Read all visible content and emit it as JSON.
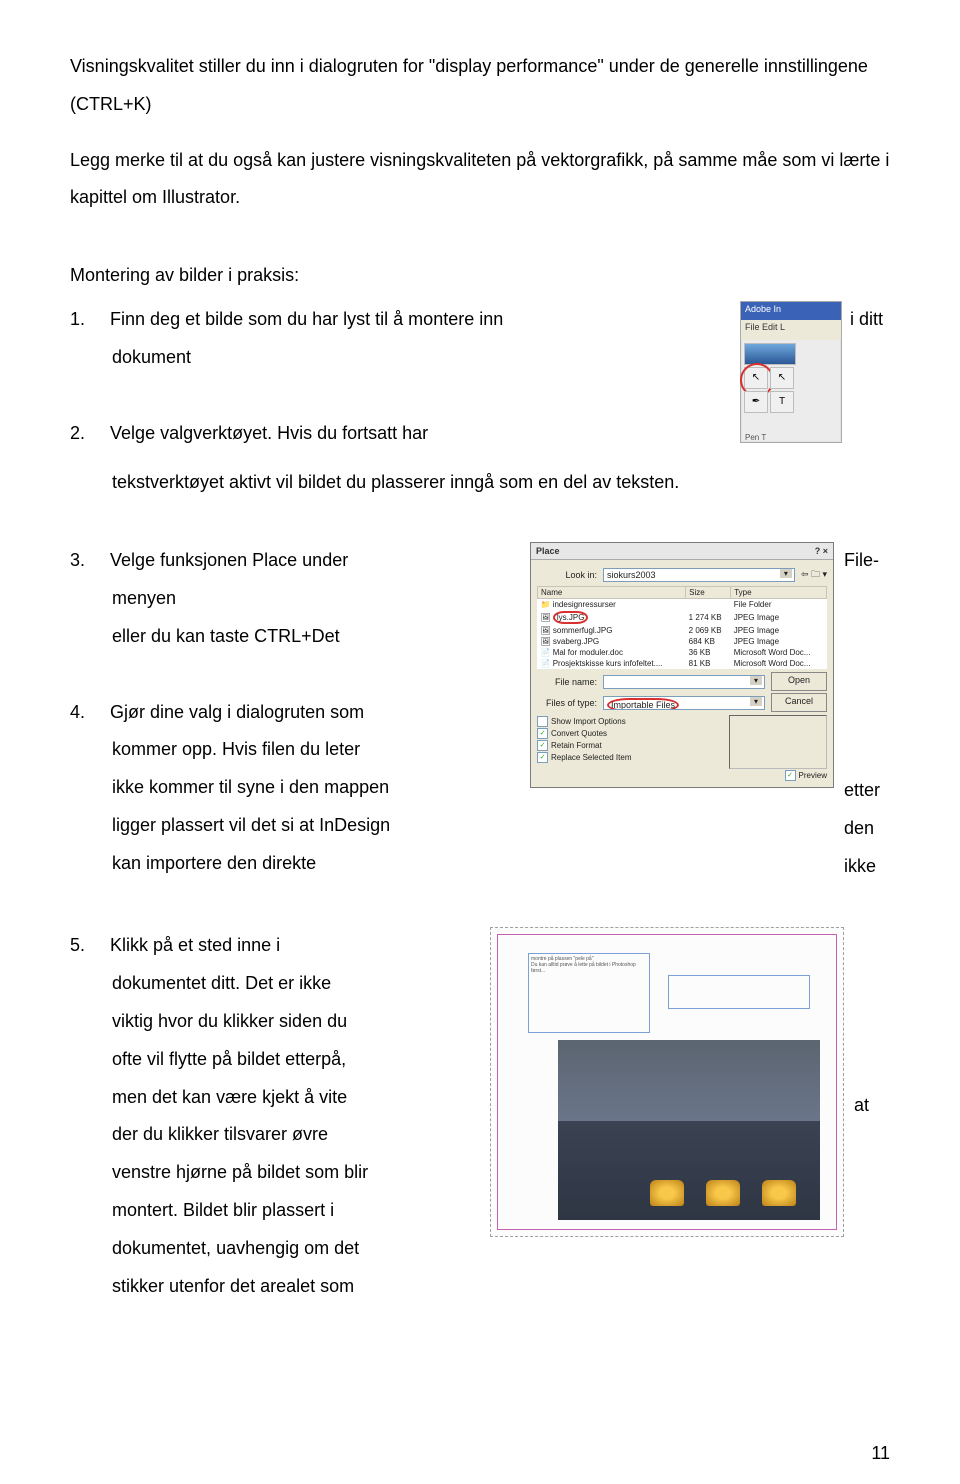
{
  "intro_para": "Visningskvalitet stiller du inn i dialogruten for \"display performance\" under de generelle innstillingene (CTRL+K)",
  "note_para": "Legg merke til at du også kan justere visningskvaliteten på vektorgrafikk, på samme måe som vi lærte i kapittel om Illustrator.",
  "section_title": "Montering av bilder i praksis:",
  "step1_a": "1.",
  "step1_b": "Finn deg et bilde som du har lyst til å montere inn",
  "step1_c": "i ditt",
  "step1_indent": "dokument",
  "step2_a": "2.",
  "step2_b": "Velge valgverktøyet. Hvis du fortsatt har",
  "step2_indent": "tekstverktøyet aktivt vil bildet du plasserer inngå som en del av teksten.",
  "step3_a": "3.",
  "step3_b": "Velge funksjonen Place under",
  "step3_c": "File-",
  "step3_indent1": "menyen",
  "step3_indent2": "eller du kan taste CTRL+Det",
  "step4_a": "4.",
  "step4_b": "Gjør dine valg i dialogruten som",
  "step4_l2a": "kommer opp. Hvis filen du leter",
  "step4_l2b": "etter",
  "step4_l3a": "ikke kommer til syne i den mappen",
  "step4_l3b": "den",
  "step4_l4a": "ligger plassert vil det si at InDesign",
  "step4_l4b": "ikke",
  "step4_l5": "kan importere den direkte",
  "step5_a": "5.",
  "step5_b": "Klikk på et sted inne i",
  "step5_l2": "dokumentet ditt. Det er ikke",
  "step5_l3": "viktig hvor du klikker siden du",
  "step5_l4": "ofte vil flytte på bildet etterpå,",
  "step5_l5a": "men det kan være kjekt å vite",
  "step5_l5b": "at",
  "step5_l6": "der du klikker tilsvarer øvre",
  "step5_l7": "venstre hjørne på bildet som blir",
  "step5_l8": "montert. Bildet blir plassert i",
  "step5_l9": "dokumentet, uavhengig om det",
  "step5_l10": "stikker utenfor det arealet som",
  "toolbar": {
    "title": "Adobe In",
    "menu": "File  Edit  L",
    "pentext": "Pen T"
  },
  "dialog": {
    "title": "Place",
    "close": "? ×",
    "lookin_label": "Look in:",
    "lookin_value": "siokurs2003",
    "cols": {
      "name": "Name",
      "size": "Size",
      "type": "Type"
    },
    "files": [
      {
        "name": "indesignressurser",
        "size": "",
        "type": "File Folder"
      },
      {
        "name": "lys.JPG",
        "size": "1 274 KB",
        "type": "JPEG Image",
        "circled": true
      },
      {
        "name": "sommerfugl.JPG",
        "size": "2 069 KB",
        "type": "JPEG Image"
      },
      {
        "name": "svaberg.JPG",
        "size": "684 KB",
        "type": "JPEG Image"
      },
      {
        "name": "Mal for moduler.doc",
        "size": "36 KB",
        "type": "Microsoft Word Doc..."
      },
      {
        "name": "Prosjektskisse kurs infofeltet....",
        "size": "81 KB",
        "type": "Microsoft Word Doc..."
      }
    ],
    "filename_label": "File name:",
    "filesof_label": "Files of type:",
    "filesof_value": "Importable Files",
    "open_btn": "Open",
    "cancel_btn": "Cancel",
    "cb_show": "Show Import Options",
    "cb_convert": "Convert Quotes",
    "cb_retain": "Retain Format",
    "cb_replace": "Replace Selected Item",
    "cb_preview": "Preview"
  },
  "page_number": "11"
}
